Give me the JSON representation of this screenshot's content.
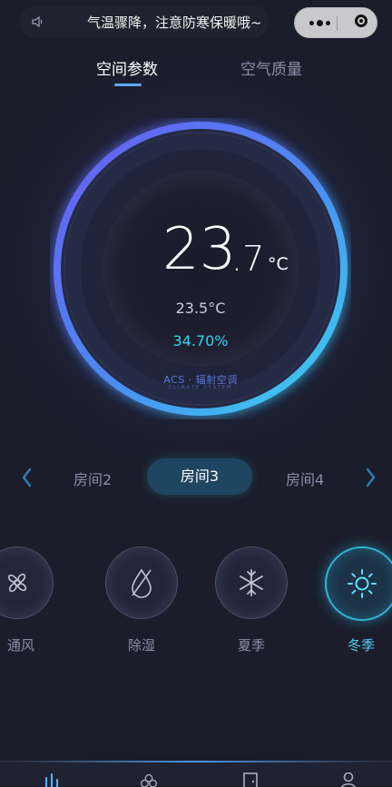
{
  "notice": {
    "text": "气温骤降，注意防寒保暖哦~"
  },
  "tabs": [
    {
      "label": "空间参数",
      "active": true
    },
    {
      "label": "空气质量",
      "active": false
    }
  ],
  "dial": {
    "temp_int": "23",
    "temp_dec": ".7",
    "temp_unit": "°C",
    "set_temp": "23.5°C",
    "humidity": "34.70%",
    "brand": "ACS · 辐射空调",
    "brand_sub": "CLIMATE SYSTEM"
  },
  "rooms": [
    {
      "label": "房间2",
      "active": false
    },
    {
      "label": "房间3",
      "active": true
    },
    {
      "label": "房间4",
      "active": false
    }
  ],
  "modes": [
    {
      "label": "通风",
      "icon": "fan-icon",
      "active": false
    },
    {
      "label": "除湿",
      "icon": "dehumidify-icon",
      "active": false
    },
    {
      "label": "夏季",
      "icon": "snowflake-icon",
      "active": false
    },
    {
      "label": "冬季",
      "icon": "sun-icon",
      "active": true
    }
  ],
  "nav": [
    {
      "icon": "stats-icon"
    },
    {
      "icon": "clover-icon"
    },
    {
      "icon": "door-icon"
    },
    {
      "icon": "user-icon"
    }
  ],
  "colors": {
    "background": "#1b1d2b",
    "accent": "#36d4ee",
    "ring_start": "#6a5cf0",
    "ring_end": "#38d8f0"
  }
}
